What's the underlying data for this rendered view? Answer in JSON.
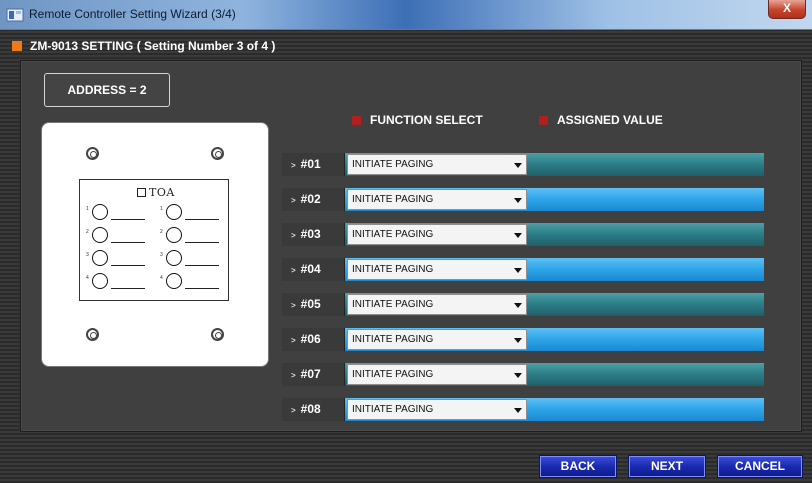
{
  "window": {
    "title": "Remote Controller Setting Wizard (3/4)",
    "close_label": "X"
  },
  "header": {
    "title": "ZM-9013 SETTING  ( Setting Number 3 of 4 )"
  },
  "address": {
    "label": "ADDRESS = 2"
  },
  "columns": {
    "function_select": "FUNCTION SELECT",
    "assigned_value": "ASSIGNED VALUE"
  },
  "device": {
    "logo": "TOA",
    "slots": [
      "1",
      "1",
      "2",
      "2",
      "3",
      "3",
      "4",
      "4"
    ]
  },
  "rows": [
    {
      "label": "#01",
      "function": "INITIATE  PAGING"
    },
    {
      "label": "#02",
      "function": "INITIATE  PAGING"
    },
    {
      "label": "#03",
      "function": "INITIATE  PAGING"
    },
    {
      "label": "#04",
      "function": "INITIATE  PAGING"
    },
    {
      "label": "#05",
      "function": "INITIATE  PAGING"
    },
    {
      "label": "#06",
      "function": "INITIATE  PAGING"
    },
    {
      "label": "#07",
      "function": "INITIATE  PAGING"
    },
    {
      "label": "#08",
      "function": "INITIATE  PAGING"
    }
  ],
  "footer": {
    "back": "BACK",
    "next": "NEXT",
    "cancel": "CANCEL"
  },
  "icons": {
    "app": "toa-app-icon",
    "dropdown": "chevron-down-icon",
    "row_arrow": "arrow-right-icon",
    "screw": "screw-icon"
  },
  "colors": {
    "accent_orange": "#f07a1a",
    "marker_red": "#b02020",
    "button_blue": "#1a2ab0",
    "row_teal": "#2d7f88",
    "row_blue": "#2ea4e8"
  }
}
